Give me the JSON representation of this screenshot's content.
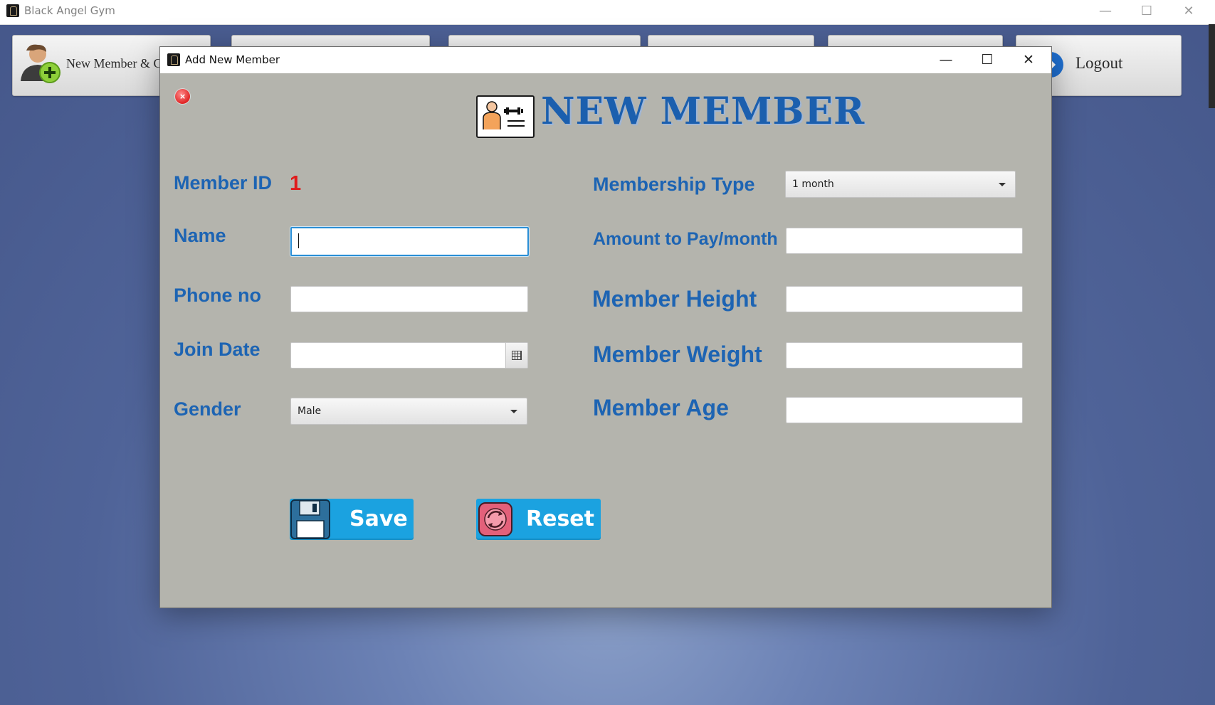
{
  "app": {
    "title": "Black Angel Gym",
    "nav": {
      "new_member_label": "New Member & Co",
      "logout_label": "Logout"
    }
  },
  "dialog": {
    "title": "Add New Member",
    "header": "NEW MEMBER",
    "labels": {
      "member_id": "Member ID",
      "name": "Name",
      "phone": "Phone no",
      "join_date": "Join Date",
      "gender": "Gender",
      "membership_type": "Membership Type",
      "amount": "Amount to Pay/month",
      "height": "Member Height",
      "weight": "Member Weight",
      "age": "Member Age"
    },
    "member_id_value": "1",
    "values": {
      "name": "",
      "phone": "",
      "join_date": "",
      "amount": "",
      "height": "",
      "weight": "",
      "age": ""
    },
    "gender_selected": "Male",
    "membership_selected": "1 month",
    "buttons": {
      "save": "Save",
      "reset": "Reset"
    },
    "close_glyph": "×"
  },
  "colors": {
    "label_blue": "#1d64b3",
    "member_id_red": "#e01b1b",
    "button_blue": "#1ba2e0",
    "dialog_bg": "#b4b4ad"
  },
  "icons": {
    "add_member": "add-user-icon",
    "logout": "logout-icon",
    "save": "floppy-disk-icon",
    "reset": "refresh-icon",
    "header": "member-id-card-icon",
    "calendar": "calendar-icon"
  }
}
